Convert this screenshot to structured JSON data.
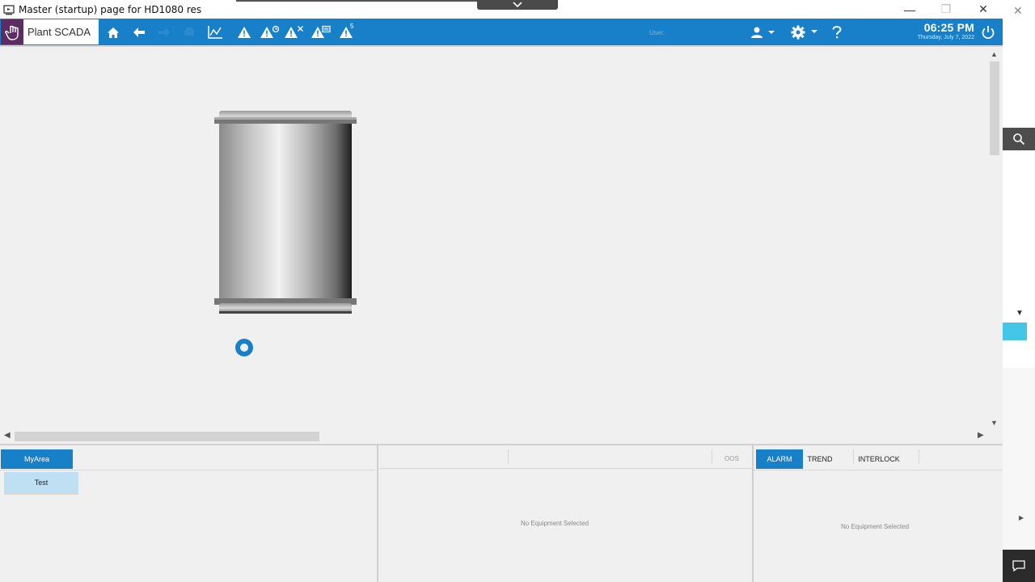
{
  "window": {
    "title": "Master (startup) page for HD1080 res",
    "minimize_glyph": "—",
    "restore_glyph": "❐",
    "close_glyph": "✕"
  },
  "toolbar": {
    "app_name": "Plant SCADA",
    "user_label": "User:",
    "time": "06:25 PM",
    "date": "Thursday, July 7, 2022",
    "icons": [
      "home-icon",
      "back-arrow-icon",
      "forward-arrow-icon",
      "print-icon",
      "trend-icon",
      "alarm-icon",
      "alarm-ack-icon",
      "alarm-clear-icon",
      "alarm-summary-icon",
      "alarm-count-icon",
      "user-icon",
      "settings-icon",
      "help-icon",
      "power-icon"
    ],
    "alarm_count_badge": "5",
    "accent_color": "#1780c8"
  },
  "canvas": {
    "equipment": "tank"
  },
  "bottom": {
    "area_tab": "MyArea",
    "area_item": "Test",
    "oos_label": "OOS",
    "equipment_empty": "No Equipment Selected",
    "tabs": [
      "ALARM",
      "TREND",
      "INTERLOCK"
    ],
    "detail_empty": "No Equipment Selected"
  },
  "right_strip": {
    "close_glyph": "✕"
  }
}
